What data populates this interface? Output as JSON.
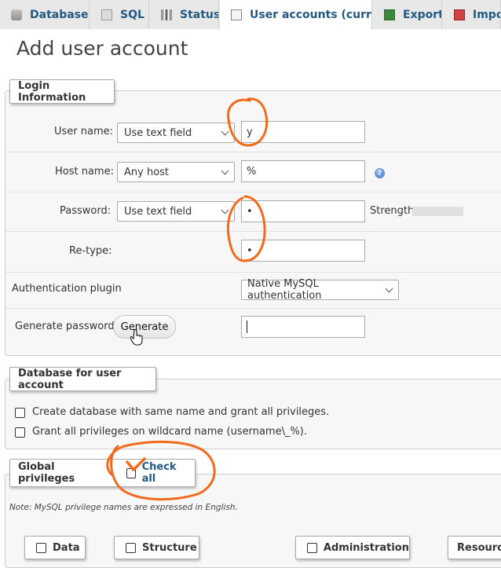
{
  "tabs": [
    {
      "label": "Databases",
      "icon": "database-icon"
    },
    {
      "label": "SQL",
      "icon": "sql-icon"
    },
    {
      "label": "Status",
      "icon": "status-icon"
    },
    {
      "label": "User accounts (current)",
      "icon": "user-accounts-icon"
    },
    {
      "label": "Export",
      "icon": "export-icon"
    },
    {
      "label": "Import",
      "icon": "import-icon"
    }
  ],
  "page_title": "Add user account",
  "login": {
    "legend": "Login Information",
    "user_name": {
      "label": "User name:",
      "select": "Use text field",
      "value": "y"
    },
    "host_name": {
      "label": "Host name:",
      "select": "Any host",
      "value": "%"
    },
    "password": {
      "label": "Password:",
      "select": "Use text field",
      "value": "•",
      "strength_label": "Strength:"
    },
    "retype": {
      "label": "Re-type:",
      "value": "•"
    },
    "auth_plugin": {
      "label": "Authentication plugin",
      "select": "Native MySQL authentication"
    },
    "generate": {
      "label": "Generate password:",
      "button": "Generate",
      "value": ""
    }
  },
  "database": {
    "legend": "Database for user account",
    "options": [
      "Create database with same name and grant all privileges.",
      "Grant all privileges on wildcard name (username\\_%)."
    ]
  },
  "global": {
    "legend": "Global privileges",
    "check_all": "Check all",
    "note": "Note: MySQL privilege names are expressed in English.",
    "groups": [
      "Data",
      "Structure",
      "Administration",
      "Resource"
    ]
  },
  "colors": {
    "link": "#235a81",
    "annotation": "#f26b1d",
    "bg_panel": "#f7f7f7"
  }
}
